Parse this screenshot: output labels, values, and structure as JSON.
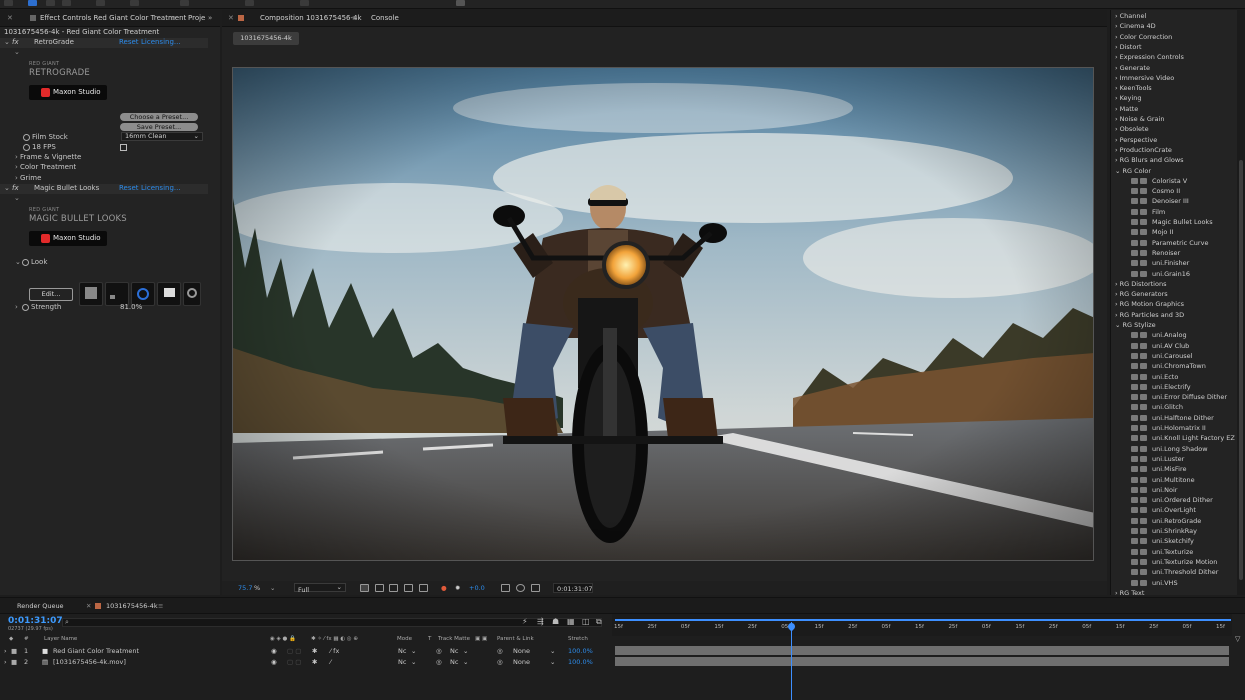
{
  "effect_controls": {
    "tab_label": "Effect Controls Red Giant Color Treatment",
    "project_tab": "Proje",
    "subtitle": "1031675456-4k - Red Giant Color Treatment",
    "retrograde": {
      "fx_label": "fx",
      "name": "RetroGrade",
      "reset": "Reset",
      "licensing": "Licensing...",
      "brand_small": "RED GIANT",
      "brand_big": "RETROGRADE",
      "maxon": "Maxon Studio",
      "choose_preset": "Choose a Preset...",
      "save_preset": "Save Preset...",
      "film_stock_label": "Film Stock",
      "film_stock_value": "16mm Clean",
      "fps_label": "18 FPS",
      "frame_vignette": "Frame & Vignette",
      "color_treatment": "Color Treatment",
      "grime": "Grime"
    },
    "mbl": {
      "fx_label": "fx",
      "name": "Magic Bullet Looks",
      "reset": "Reset",
      "licensing": "Licensing...",
      "brand_small": "RED GIANT",
      "brand_big": "MAGIC BULLET LOOKS",
      "maxon": "Maxon Studio",
      "look_label": "Look",
      "edit_button": "Edit...",
      "strength_label": "Strength",
      "strength_value": "81.0%"
    }
  },
  "composition": {
    "tab_label": "Composition 1031675456-4k",
    "console_tab": "Console",
    "flowchart_chip": "1031675456-4k",
    "zoom": "75.7",
    "zoom_unit": "%",
    "resolution": "Full",
    "exposure": "+0.0",
    "timecode": "0:01:31:07"
  },
  "effects_presets": {
    "categories_top": [
      "Channel",
      "Cinema 4D",
      "Color Correction",
      "Distort",
      "Expression Controls",
      "Generate",
      "Immersive Video",
      "KeenTools",
      "Keying",
      "Matte",
      "Noise & Grain",
      "Obsolete",
      "Perspective",
      "ProductionCrate",
      "RG Blurs and Glows"
    ],
    "rg_color": {
      "label": "RG Color",
      "items": [
        "Colorista V",
        "Cosmo II",
        "Denoiser III",
        "Film",
        "Magic Bullet Looks",
        "Mojo II",
        "Parametric Curve",
        "Renoiser",
        "uni.Finisher",
        "uni.Grain16"
      ]
    },
    "categories_mid": [
      "RG Distortions",
      "RG Generators",
      "RG Motion Graphics",
      "RG Particles and 3D"
    ],
    "rg_stylize": {
      "label": "RG Stylize",
      "items": [
        "uni.Analog",
        "uni.AV Club",
        "uni.Carousel",
        "uni.ChromaTown",
        "uni.Ecto",
        "uni.Electrify",
        "uni.Error Diffuse Dither",
        "uni.Glitch",
        "uni.Halftone Dither",
        "uni.Holomatrix II",
        "uni.Knoll Light Factory EZ",
        "uni.Long Shadow",
        "uni.Luster",
        "uni.MisFire",
        "uni.Multitone",
        "uni.Noir",
        "uni.Ordered Dither",
        "uni.OverLight",
        "uni.RetroGrade",
        "uni.ShrinkRay",
        "uni.Sketchify",
        "uni.Texturize",
        "uni.Texturize Motion",
        "uni.Threshold Dither",
        "uni.VHS"
      ]
    },
    "categories_bottom": [
      "RG Text"
    ]
  },
  "timeline": {
    "render_queue_tab": "Render Queue",
    "comp_tab": "1031675456-4k",
    "timecode": "0:01:31:07",
    "fps": "02737 (29.97 fps)",
    "search_placeholder": "",
    "columns": {
      "num": "#",
      "layer_name": "Layer Name",
      "mode": "Mode",
      "t": "T",
      "track_matte": "Track Matte",
      "parent": "Parent & Link",
      "stretch": "Stretch"
    },
    "layers": [
      {
        "num": "1",
        "name": "Red Giant Color Treatment",
        "mode": "Nc",
        "matte": "Nc",
        "parent": "None",
        "stretch": "100.0%"
      },
      {
        "num": "2",
        "name": "[1031675456-4k.mov]",
        "mode": "Nc",
        "matte": "Nc",
        "parent": "None",
        "stretch": "100.0%"
      }
    ],
    "ruler_labels": [
      "15f",
      "25f",
      "05f",
      "15f",
      "25f",
      "05f",
      "15f",
      "25f",
      "05f",
      "15f",
      "25f",
      "05f",
      "15f",
      "25f",
      "05f",
      "15f",
      "25f",
      "05f",
      "15f"
    ],
    "playhead_fraction": 0.29
  },
  "colors": {
    "accent": "#2d8ceb",
    "panel": "#232323",
    "track": "#6f6f6f"
  }
}
